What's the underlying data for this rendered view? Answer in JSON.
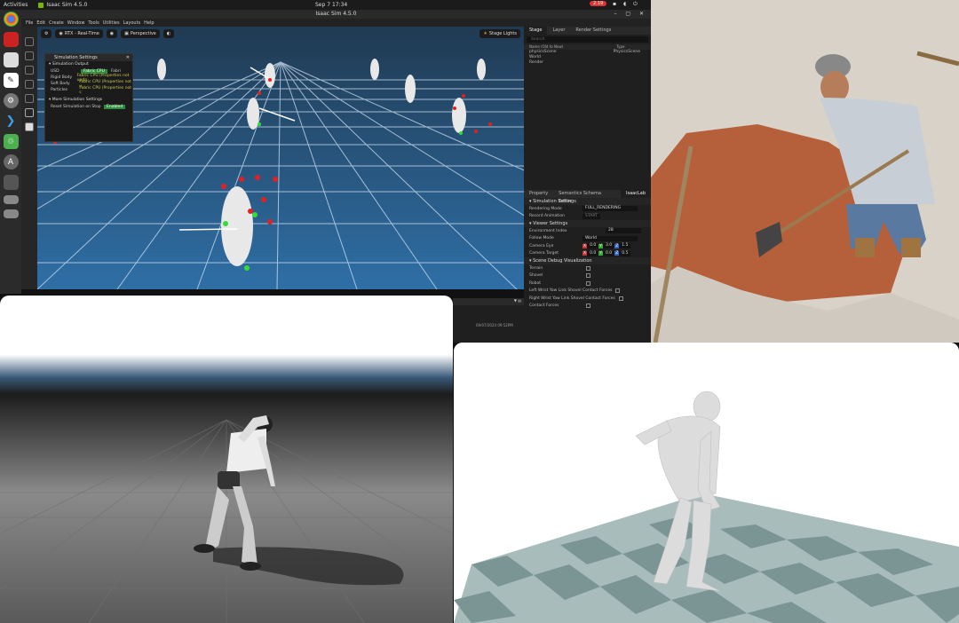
{
  "topbar": {
    "activities": "Activities",
    "app_name": "Isaac Sim 4.5.0",
    "clock": "Sep 7  17:34",
    "record": "2:19"
  },
  "window": {
    "title": "Isaac Sim 4.5.0",
    "menu": [
      "File",
      "Edit",
      "Create",
      "Window",
      "Tools",
      "Utilities",
      "Layouts",
      "Help"
    ]
  },
  "viewport": {
    "rtx_label": "RTX - Real-Time",
    "camera_label": "Perspective",
    "lights_label": "Stage Lights"
  },
  "sim_popup": {
    "title": "Simulation Settings",
    "output_header": "Simulation Output",
    "usd_label": "USD",
    "usd_value": "Fabric CPU",
    "usd_value2": "Fabri",
    "rigid_label": "Rigid Body",
    "rigid_value": "Fabric CPU (Properties not upda",
    "soft_label": "Soft Body",
    "soft_value": "Fabric CPU (Properties not u",
    "particles_label": "Particles",
    "particles_value": "Fabric CPU (Properties not c",
    "more_header": "More Simulation Settings",
    "reset_label": "Reset Simulation on Stop",
    "reset_value": "Enabled"
  },
  "stage": {
    "tabs": [
      "Stage",
      "Layer",
      "Render Settings"
    ],
    "search_placeholder": "Search",
    "col_name": "Name (Old to New)",
    "col_type": "Type",
    "items": [
      {
        "name": "physicsScene",
        "type": "PhysicsScene"
      },
      {
        "name": "World",
        "type": ""
      },
      {
        "name": "Render",
        "type": ""
      }
    ]
  },
  "props": {
    "tabs": [
      "Property",
      "Semantics Schema Editor",
      "IsaacLab"
    ],
    "sim_header": "Simulation Settings",
    "rendering_label": "Rendering Mode",
    "rendering_value": "FULL_RENDERING",
    "record_label": "Record Animation",
    "record_value": "START",
    "viewer_header": "Viewer Settings",
    "env_label": "Environment Index",
    "env_value": "28",
    "follow_label": "Follow Mode",
    "follow_value": "World",
    "eye_label": "Camera Eye",
    "eye": [
      "0.0",
      "3.0",
      "1.5"
    ],
    "target_label": "Camera Target",
    "target": [
      "0.0",
      "0.0",
      "0.5"
    ],
    "debug_header": "Scene Debug Visualization",
    "checks": [
      "Terrain",
      "Shovel",
      "Robot",
      "Left Wrist Yaw Link Shovel Contact Forces",
      "Right Wrist Yaw Link Shovel Contact Forces",
      "Contact Forces"
    ]
  },
  "console": {
    "timestamp": "09/07/2024 09:52PM"
  },
  "colors": {
    "accent_green": "#2e8b3a",
    "viewport_blue": "#1e3f5c"
  }
}
